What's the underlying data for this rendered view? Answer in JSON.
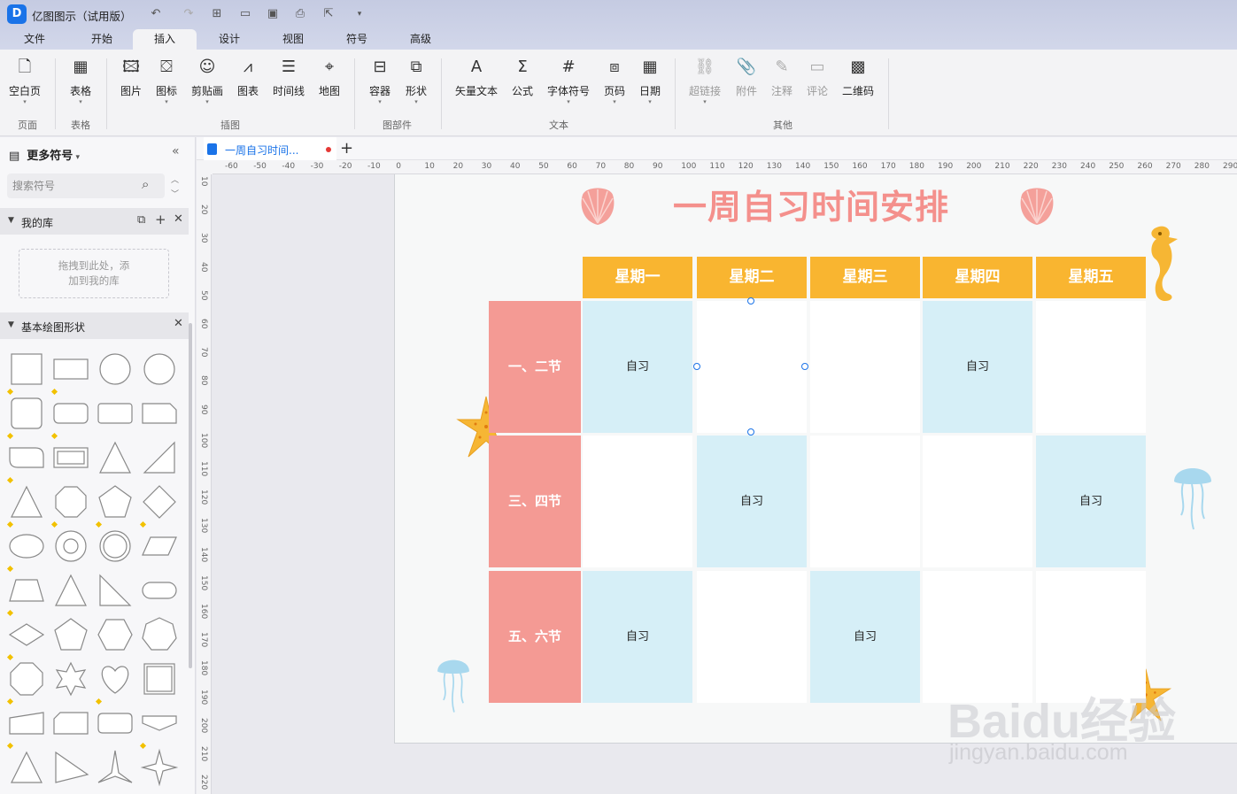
{
  "app": {
    "title": "亿图图示（试用版）",
    "logo": "D"
  },
  "quick_access": [
    "undo-icon",
    "redo-icon",
    "new-page-icon",
    "open-folder-icon",
    "save-icon",
    "print-icon",
    "export-icon",
    "more-icon"
  ],
  "menu_tabs": [
    "文件",
    "开始",
    "插入",
    "设计",
    "视图",
    "符号",
    "高级"
  ],
  "active_tab": "插入",
  "ribbon": {
    "page": {
      "blank_page": "空白页",
      "group": "页面"
    },
    "table": {
      "table": "表格",
      "group": "表格"
    },
    "illustration": {
      "picture": "图片",
      "icon": "图标",
      "clipart": "剪贴画",
      "chart": "图表",
      "timeline": "时间线",
      "map": "地图",
      "group": "插图"
    },
    "parts": {
      "container": "容器",
      "shape": "形状",
      "group": "图部件"
    },
    "text": {
      "vector_text": "矢量文本",
      "formula": "公式",
      "font_symbol": "字体符号",
      "page_number": "页码",
      "date": "日期",
      "group": "文本"
    },
    "other": {
      "hyperlink": "超链接",
      "attachment": "附件",
      "note": "注释",
      "comment": "评论",
      "qrcode": "二维码",
      "group": "其他"
    }
  },
  "sidebar": {
    "title": "更多符号",
    "search_placeholder": "搜索符号",
    "my_library": "我的库",
    "drop_hint_1": "拖拽到此处，添",
    "drop_hint_2": "加到我的库",
    "basic_shapes": "基本绘图形状"
  },
  "document": {
    "tab_label": "一周自习时间..."
  },
  "rulers": {
    "h": [
      "-60",
      "-50",
      "-40",
      "-30",
      "-20",
      "-10",
      "0",
      "10",
      "20",
      "30",
      "40",
      "50",
      "60",
      "70",
      "80",
      "90",
      "100",
      "110",
      "120",
      "130",
      "140",
      "150",
      "160",
      "170",
      "180",
      "190",
      "200",
      "210",
      "220",
      "230",
      "240",
      "250",
      "260",
      "270",
      "280",
      "290"
    ],
    "v": [
      "10",
      "20",
      "30",
      "40",
      "50",
      "60",
      "70",
      "80",
      "90",
      "100",
      "110",
      "120",
      "130",
      "140",
      "150",
      "160",
      "170",
      "180",
      "190",
      "200",
      "210",
      "220"
    ]
  },
  "poster": {
    "title": "一周自习时间安排",
    "days": [
      "星期一",
      "星期二",
      "星期三",
      "星期四",
      "星期五"
    ],
    "periods": [
      "一、二节",
      "三、四节",
      "五、六节"
    ],
    "cell_text": "自习",
    "grid": [
      [
        "自习",
        "",
        "",
        "自习",
        ""
      ],
      [
        "",
        "自习",
        "",
        "",
        "自习"
      ],
      [
        "自习",
        "",
        "自习",
        "",
        ""
      ]
    ],
    "colors": {
      "header": "#f9b530",
      "row_header": "#f49a94",
      "study_cell": "#d6eff7",
      "title": "#f4908c"
    }
  },
  "watermark": {
    "logo": "Baidu经验",
    "url": "jingyan.baidu.com"
  }
}
